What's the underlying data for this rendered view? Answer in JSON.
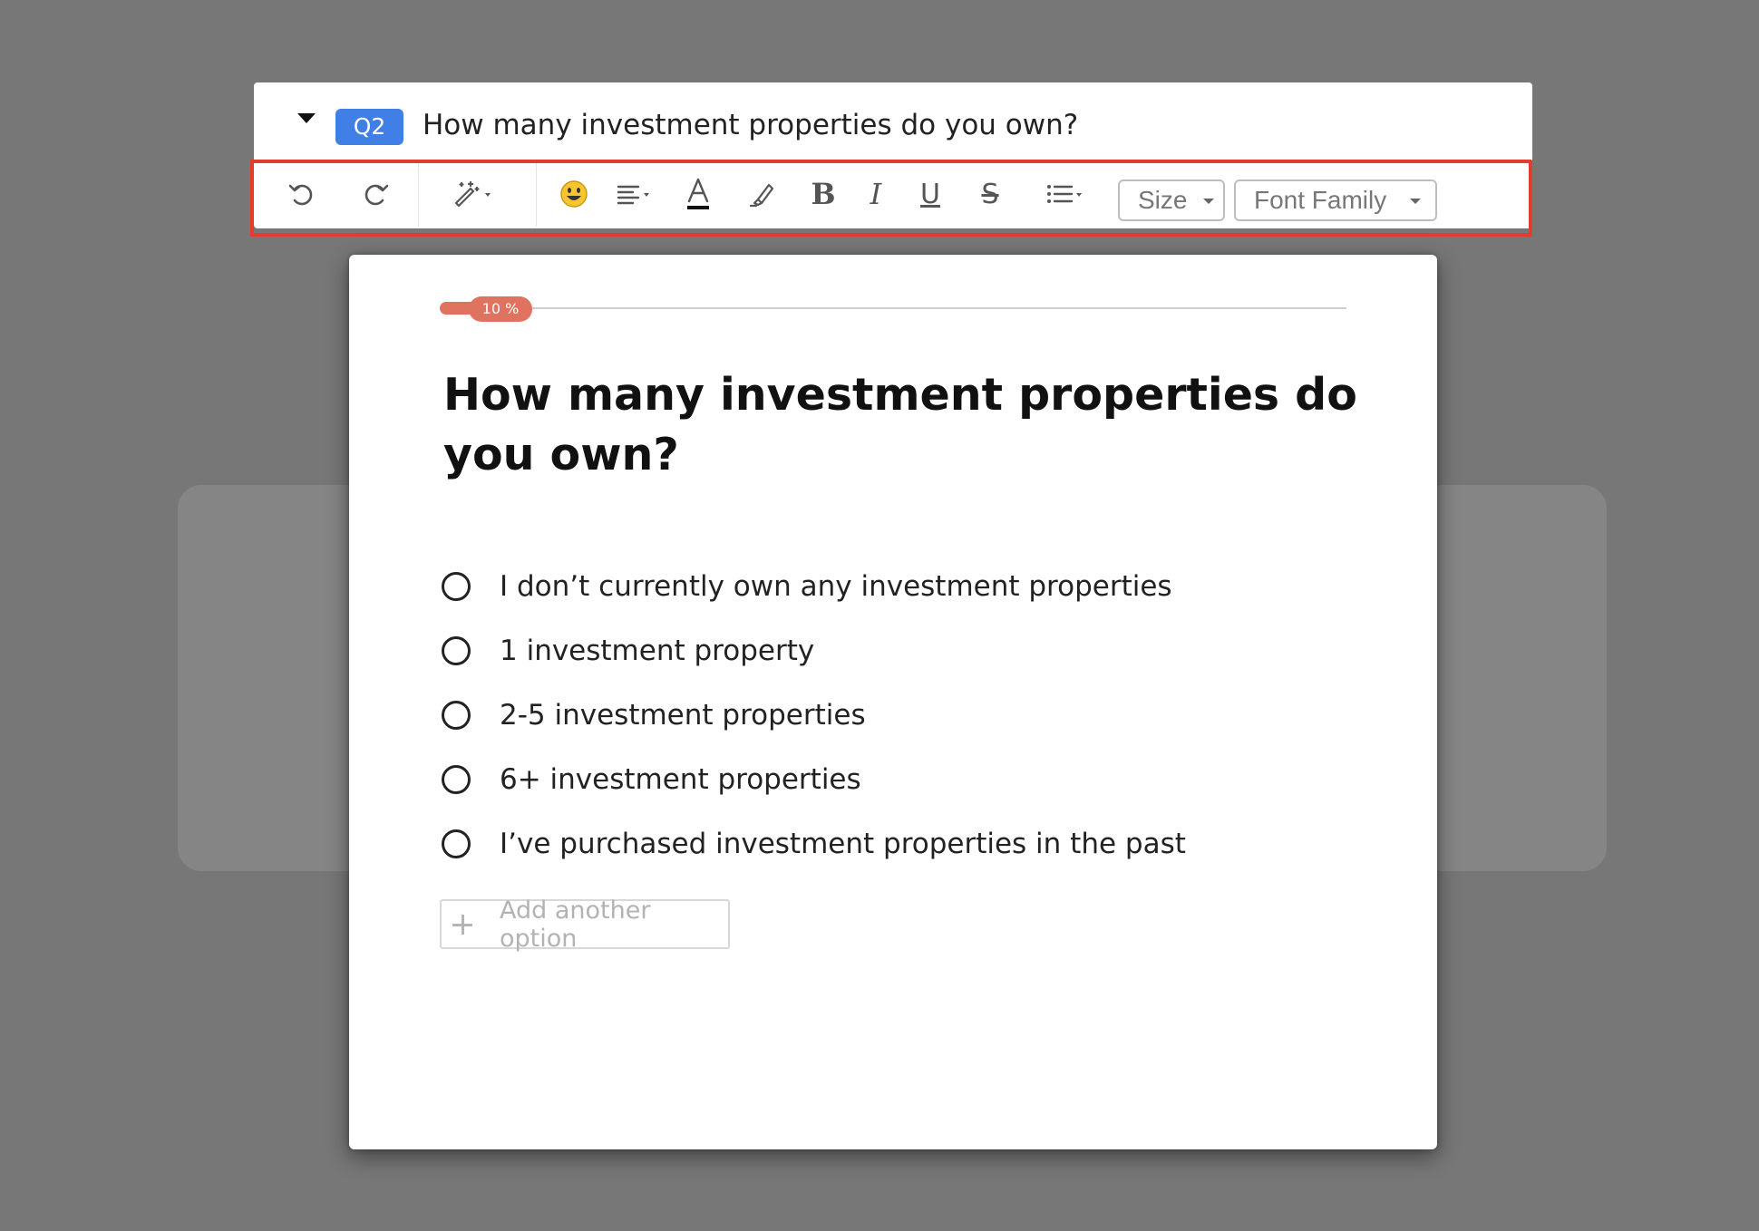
{
  "header": {
    "badge": "Q2",
    "question_title": "How many investment properties do you own?"
  },
  "toolbar": {
    "tools": [
      {
        "name": "undo",
        "icon": "undo-icon"
      },
      {
        "name": "redo",
        "icon": "redo-icon"
      },
      {
        "name": "magic-format",
        "icon": "magic-wand-icon"
      },
      {
        "name": "emoji",
        "icon": "smiley-icon"
      },
      {
        "name": "align",
        "icon": "align-left-icon"
      },
      {
        "name": "text-color",
        "icon": "font-color-icon"
      },
      {
        "name": "highlight",
        "icon": "highlighter-icon"
      },
      {
        "name": "bold",
        "icon": "bold-icon"
      },
      {
        "name": "italic",
        "icon": "italic-icon"
      },
      {
        "name": "underline",
        "icon": "underline-icon"
      },
      {
        "name": "strikethrough",
        "icon": "strikethrough-icon"
      },
      {
        "name": "list",
        "icon": "list-icon"
      }
    ],
    "size_label": "Size",
    "font_family_label": "Font Family",
    "highlight_color": "#e23c2c"
  },
  "preview": {
    "progress_label": "10 %",
    "progress_fraction": 0.1,
    "progress_color": "#e07260",
    "question_heading": "How many investment properties do you own?",
    "options": [
      "I don’t currently own any investment properties",
      "1 investment property",
      "2-5 investment properties",
      "6+ investment properties",
      "I’ve purchased investment properties in the past"
    ],
    "add_option_label": "Add another option"
  },
  "colors": {
    "badge": "#3f7fe6",
    "background": "#777777"
  }
}
